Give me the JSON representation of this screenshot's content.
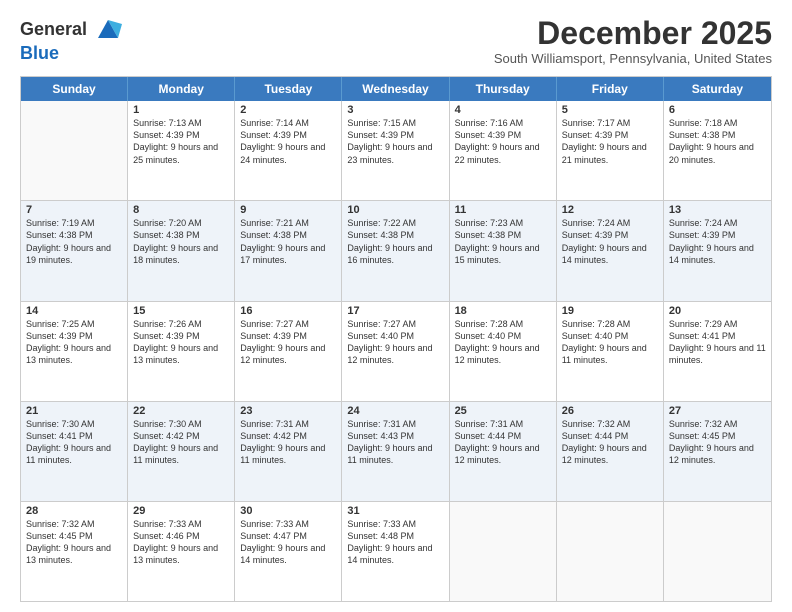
{
  "header": {
    "logo_line1": "General",
    "logo_line2": "Blue",
    "month": "December 2025",
    "location": "South Williamsport, Pennsylvania, United States"
  },
  "days_of_week": [
    "Sunday",
    "Monday",
    "Tuesday",
    "Wednesday",
    "Thursday",
    "Friday",
    "Saturday"
  ],
  "weeks": [
    [
      {
        "day": "",
        "sunrise": "",
        "sunset": "",
        "daylight": ""
      },
      {
        "day": "1",
        "sunrise": "Sunrise: 7:13 AM",
        "sunset": "Sunset: 4:39 PM",
        "daylight": "Daylight: 9 hours and 25 minutes."
      },
      {
        "day": "2",
        "sunrise": "Sunrise: 7:14 AM",
        "sunset": "Sunset: 4:39 PM",
        "daylight": "Daylight: 9 hours and 24 minutes."
      },
      {
        "day": "3",
        "sunrise": "Sunrise: 7:15 AM",
        "sunset": "Sunset: 4:39 PM",
        "daylight": "Daylight: 9 hours and 23 minutes."
      },
      {
        "day": "4",
        "sunrise": "Sunrise: 7:16 AM",
        "sunset": "Sunset: 4:39 PM",
        "daylight": "Daylight: 9 hours and 22 minutes."
      },
      {
        "day": "5",
        "sunrise": "Sunrise: 7:17 AM",
        "sunset": "Sunset: 4:39 PM",
        "daylight": "Daylight: 9 hours and 21 minutes."
      },
      {
        "day": "6",
        "sunrise": "Sunrise: 7:18 AM",
        "sunset": "Sunset: 4:38 PM",
        "daylight": "Daylight: 9 hours and 20 minutes."
      }
    ],
    [
      {
        "day": "7",
        "sunrise": "Sunrise: 7:19 AM",
        "sunset": "Sunset: 4:38 PM",
        "daylight": "Daylight: 9 hours and 19 minutes."
      },
      {
        "day": "8",
        "sunrise": "Sunrise: 7:20 AM",
        "sunset": "Sunset: 4:38 PM",
        "daylight": "Daylight: 9 hours and 18 minutes."
      },
      {
        "day": "9",
        "sunrise": "Sunrise: 7:21 AM",
        "sunset": "Sunset: 4:38 PM",
        "daylight": "Daylight: 9 hours and 17 minutes."
      },
      {
        "day": "10",
        "sunrise": "Sunrise: 7:22 AM",
        "sunset": "Sunset: 4:38 PM",
        "daylight": "Daylight: 9 hours and 16 minutes."
      },
      {
        "day": "11",
        "sunrise": "Sunrise: 7:23 AM",
        "sunset": "Sunset: 4:38 PM",
        "daylight": "Daylight: 9 hours and 15 minutes."
      },
      {
        "day": "12",
        "sunrise": "Sunrise: 7:24 AM",
        "sunset": "Sunset: 4:39 PM",
        "daylight": "Daylight: 9 hours and 14 minutes."
      },
      {
        "day": "13",
        "sunrise": "Sunrise: 7:24 AM",
        "sunset": "Sunset: 4:39 PM",
        "daylight": "Daylight: 9 hours and 14 minutes."
      }
    ],
    [
      {
        "day": "14",
        "sunrise": "Sunrise: 7:25 AM",
        "sunset": "Sunset: 4:39 PM",
        "daylight": "Daylight: 9 hours and 13 minutes."
      },
      {
        "day": "15",
        "sunrise": "Sunrise: 7:26 AM",
        "sunset": "Sunset: 4:39 PM",
        "daylight": "Daylight: 9 hours and 13 minutes."
      },
      {
        "day": "16",
        "sunrise": "Sunrise: 7:27 AM",
        "sunset": "Sunset: 4:39 PM",
        "daylight": "Daylight: 9 hours and 12 minutes."
      },
      {
        "day": "17",
        "sunrise": "Sunrise: 7:27 AM",
        "sunset": "Sunset: 4:40 PM",
        "daylight": "Daylight: 9 hours and 12 minutes."
      },
      {
        "day": "18",
        "sunrise": "Sunrise: 7:28 AM",
        "sunset": "Sunset: 4:40 PM",
        "daylight": "Daylight: 9 hours and 12 minutes."
      },
      {
        "day": "19",
        "sunrise": "Sunrise: 7:28 AM",
        "sunset": "Sunset: 4:40 PM",
        "daylight": "Daylight: 9 hours and 11 minutes."
      },
      {
        "day": "20",
        "sunrise": "Sunrise: 7:29 AM",
        "sunset": "Sunset: 4:41 PM",
        "daylight": "Daylight: 9 hours and 11 minutes."
      }
    ],
    [
      {
        "day": "21",
        "sunrise": "Sunrise: 7:30 AM",
        "sunset": "Sunset: 4:41 PM",
        "daylight": "Daylight: 9 hours and 11 minutes."
      },
      {
        "day": "22",
        "sunrise": "Sunrise: 7:30 AM",
        "sunset": "Sunset: 4:42 PM",
        "daylight": "Daylight: 9 hours and 11 minutes."
      },
      {
        "day": "23",
        "sunrise": "Sunrise: 7:31 AM",
        "sunset": "Sunset: 4:42 PM",
        "daylight": "Daylight: 9 hours and 11 minutes."
      },
      {
        "day": "24",
        "sunrise": "Sunrise: 7:31 AM",
        "sunset": "Sunset: 4:43 PM",
        "daylight": "Daylight: 9 hours and 11 minutes."
      },
      {
        "day": "25",
        "sunrise": "Sunrise: 7:31 AM",
        "sunset": "Sunset: 4:44 PM",
        "daylight": "Daylight: 9 hours and 12 minutes."
      },
      {
        "day": "26",
        "sunrise": "Sunrise: 7:32 AM",
        "sunset": "Sunset: 4:44 PM",
        "daylight": "Daylight: 9 hours and 12 minutes."
      },
      {
        "day": "27",
        "sunrise": "Sunrise: 7:32 AM",
        "sunset": "Sunset: 4:45 PM",
        "daylight": "Daylight: 9 hours and 12 minutes."
      }
    ],
    [
      {
        "day": "28",
        "sunrise": "Sunrise: 7:32 AM",
        "sunset": "Sunset: 4:45 PM",
        "daylight": "Daylight: 9 hours and 13 minutes."
      },
      {
        "day": "29",
        "sunrise": "Sunrise: 7:33 AM",
        "sunset": "Sunset: 4:46 PM",
        "daylight": "Daylight: 9 hours and 13 minutes."
      },
      {
        "day": "30",
        "sunrise": "Sunrise: 7:33 AM",
        "sunset": "Sunset: 4:47 PM",
        "daylight": "Daylight: 9 hours and 14 minutes."
      },
      {
        "day": "31",
        "sunrise": "Sunrise: 7:33 AM",
        "sunset": "Sunset: 4:48 PM",
        "daylight": "Daylight: 9 hours and 14 minutes."
      },
      {
        "day": "",
        "sunrise": "",
        "sunset": "",
        "daylight": ""
      },
      {
        "day": "",
        "sunrise": "",
        "sunset": "",
        "daylight": ""
      },
      {
        "day": "",
        "sunrise": "",
        "sunset": "",
        "daylight": ""
      }
    ]
  ]
}
